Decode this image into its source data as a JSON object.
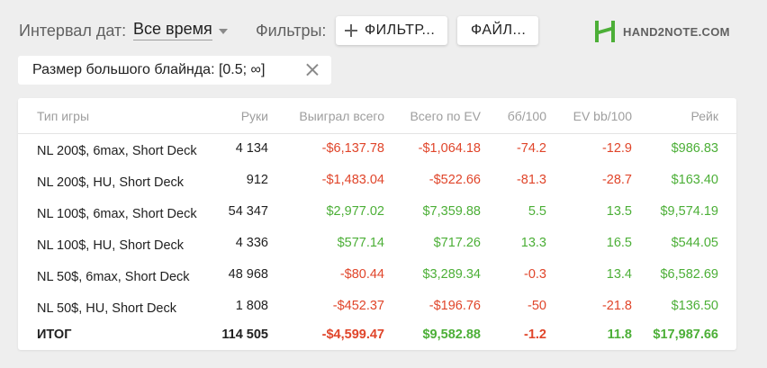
{
  "toolbar": {
    "interval_label": "Интервал дат:",
    "interval_value": "Все время",
    "filters_label": "Фильтры:",
    "filter_button": "ФИЛЬТР...",
    "file_button": "ФАЙЛ..."
  },
  "logo": {
    "text": "HAND2NOTE.COM"
  },
  "chip": {
    "label": "Размер большого блайнда: [0.5; ∞]"
  },
  "colors": {
    "negative": "#e0452a",
    "positive": "#4caf37",
    "logo": "#4caf37"
  },
  "table": {
    "headers": [
      "Тип игры",
      "Руки",
      "Выиграл всего",
      "Всего по EV",
      "бб/100",
      "EV bb/100",
      "Рейк"
    ],
    "rows": [
      {
        "game": "NL 200$, 6max, Short Deck",
        "hands": "4 134",
        "won": "-$6,137.78",
        "ev": "-$1,064.18",
        "bb100": "-74.2",
        "evbb100": "-12.9",
        "rake": "$986.83"
      },
      {
        "game": "NL 200$, HU, Short Deck",
        "hands": "912",
        "won": "-$1,483.04",
        "ev": "-$522.66",
        "bb100": "-81.3",
        "evbb100": "-28.7",
        "rake": "$163.40"
      },
      {
        "game": "NL 100$, 6max, Short Deck",
        "hands": "54 347",
        "won": "$2,977.02",
        "ev": "$7,359.88",
        "bb100": "5.5",
        "evbb100": "13.5",
        "rake": "$9,574.19"
      },
      {
        "game": "NL 100$, HU, Short Deck",
        "hands": "4 336",
        "won": "$577.14",
        "ev": "$717.26",
        "bb100": "13.3",
        "evbb100": "16.5",
        "rake": "$544.05"
      },
      {
        "game": "NL 50$, 6max, Short Deck",
        "hands": "48 968",
        "won": "-$80.44",
        "ev": "$3,289.34",
        "bb100": "-0.3",
        "evbb100": "13.4",
        "rake": "$6,582.69"
      },
      {
        "game": "NL 50$, HU, Short Deck",
        "hands": "1 808",
        "won": "-$452.37",
        "ev": "-$196.76",
        "bb100": "-50",
        "evbb100": "-21.8",
        "rake": "$136.50"
      }
    ],
    "total": {
      "game": "ИТОГ",
      "hands": "114 505",
      "won": "-$4,599.47",
      "ev": "$9,582.88",
      "bb100": "-1.2",
      "evbb100": "11.8",
      "rake": "$17,987.66"
    }
  }
}
